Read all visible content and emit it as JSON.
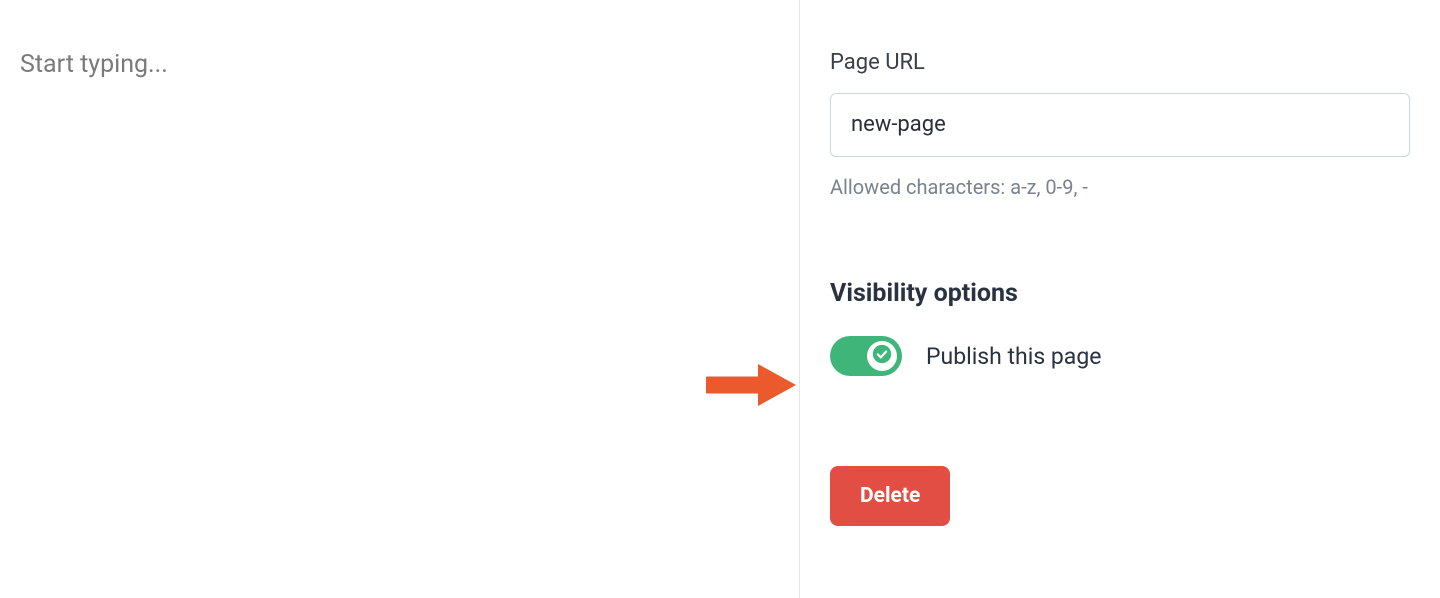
{
  "editor": {
    "placeholder": "Start typing..."
  },
  "settings": {
    "page_url": {
      "label": "Page URL",
      "value": "new-page",
      "helper": "Allowed characters: a-z, 0-9, -"
    },
    "visibility": {
      "heading": "Visibility options",
      "publish_label": "Publish this page",
      "publish_state": true
    },
    "delete_label": "Delete"
  },
  "colors": {
    "toggle_on": "#3fb57a",
    "danger": "#e24d44",
    "arrow": "#ea5a2d"
  }
}
